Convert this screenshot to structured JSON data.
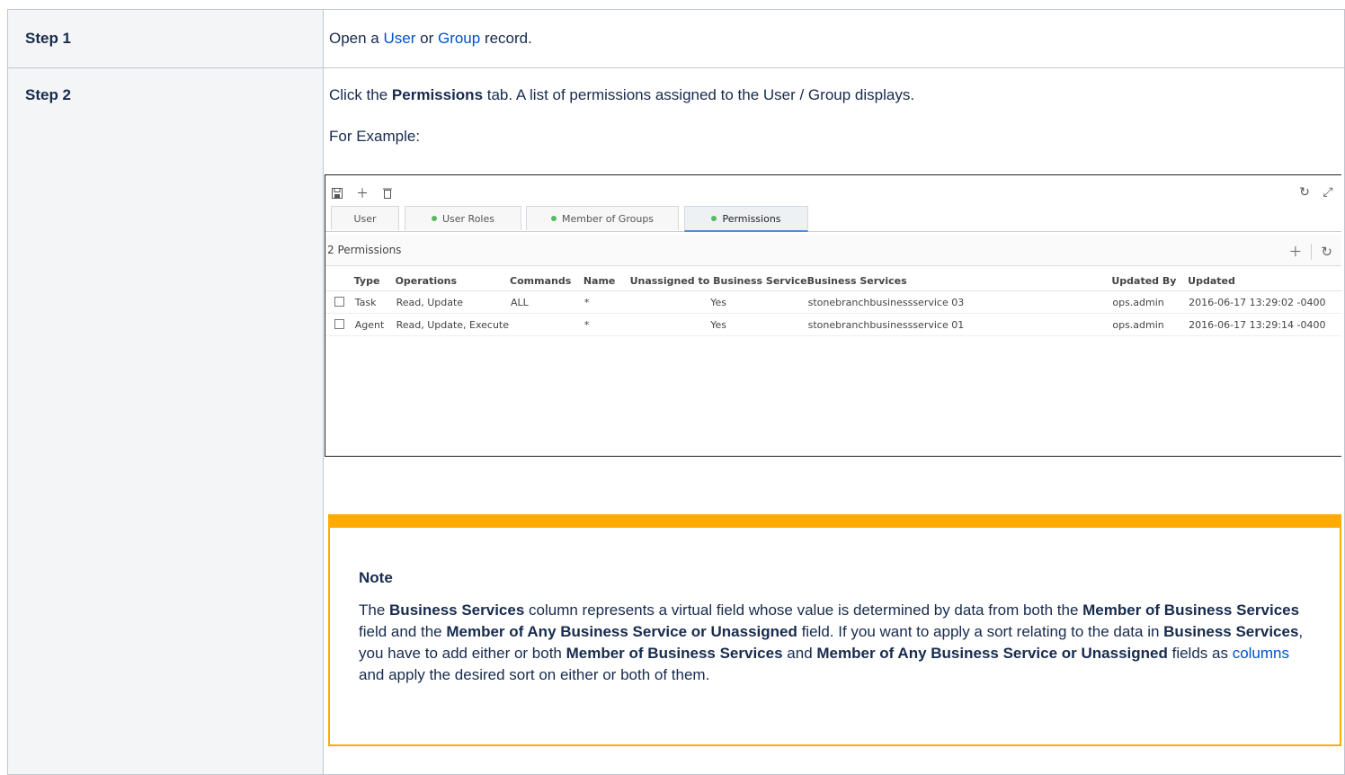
{
  "steps": [
    {
      "label": "Step 1",
      "text_before": "Open a ",
      "link1": "User",
      "text_mid": " or ",
      "link2": "Group",
      "text_after": " record."
    },
    {
      "label": "Step 2",
      "text_before": "Click the ",
      "bold": "Permissions",
      "text_after": " tab. A list of permissions assigned to the User / Group displays.",
      "example": "For Example:"
    }
  ],
  "screenshot": {
    "tabs": [
      {
        "label": "User",
        "dot": false
      },
      {
        "label": "User Roles",
        "dot": true
      },
      {
        "label": "Member of Groups",
        "dot": true
      },
      {
        "label": "Permissions",
        "dot": true,
        "active": true
      }
    ],
    "count_label": "2 Permissions",
    "columns": [
      "Type",
      "Operations",
      "Commands",
      "Name",
      "Unassigned to Business Service",
      "Business Services",
      "Updated By",
      "Updated"
    ],
    "rows": [
      [
        "Task",
        "Read, Update",
        "ALL",
        "*",
        "Yes",
        "stonebranchbusinessservice 03",
        "ops.admin",
        "2016-06-17 13:29:02 -0400"
      ],
      [
        "Agent",
        "Read, Update, Execute",
        "",
        "*",
        "Yes",
        "stonebranchbusinessservice 01",
        "ops.admin",
        "2016-06-17 13:29:14 -0400"
      ]
    ],
    "status_color": "#5cb85c"
  },
  "note": {
    "title": "Note",
    "t1": "The ",
    "b1": "Business Services",
    "t2": " column represents a virtual field whose value is determined by data from both the ",
    "b2": "Member of Business Services",
    "t3": " field and the ",
    "b3": "Member of Any Business Service or Unassigned",
    "t4": " field. If you want to apply a sort relating to the data in ",
    "b4": "Business Services",
    "t5": ", you have to add either or both ",
    "b5": "Member of Business Services",
    "t6": " and ",
    "b6": "Member of Any Business Service or Unassigned",
    "t7": " fields as ",
    "link": "columns",
    "t8": " and apply the desired sort on either or both of them.",
    "accent_color": "#ffab00"
  }
}
